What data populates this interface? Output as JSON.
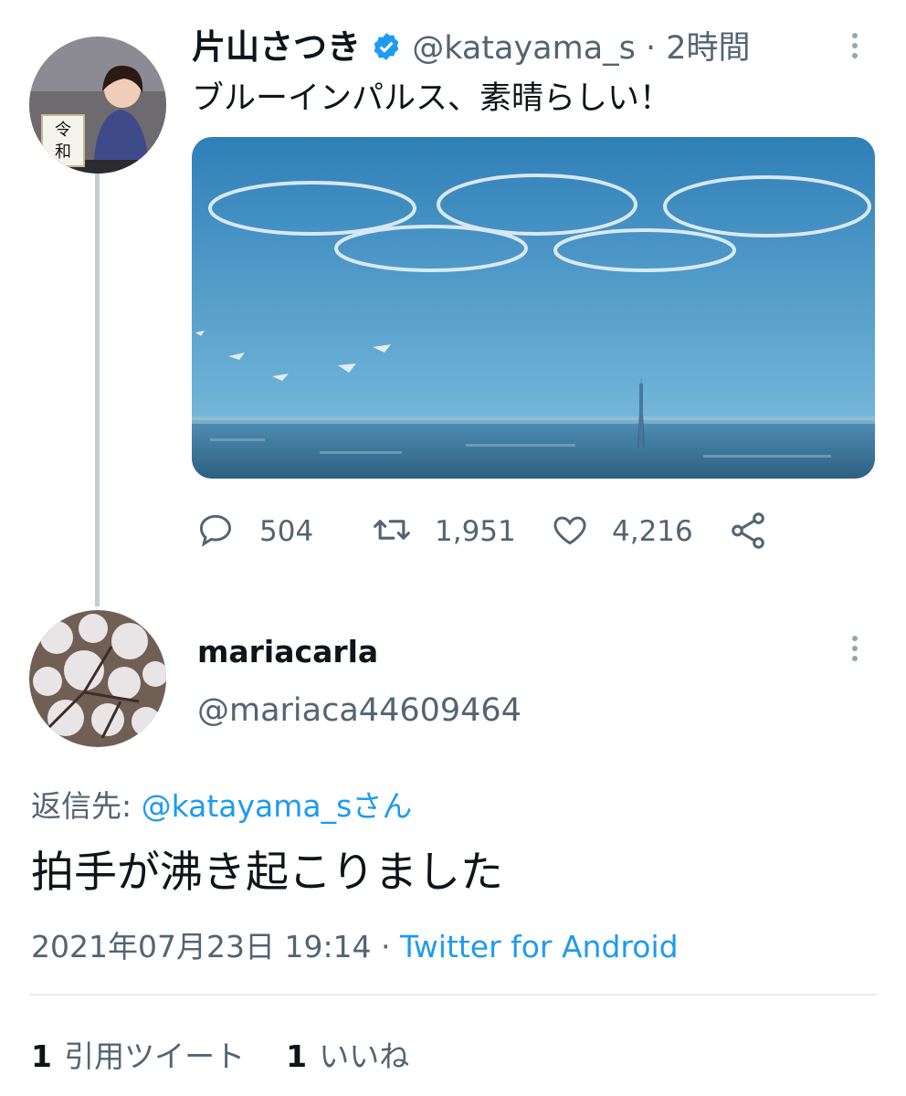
{
  "tweet": {
    "author_name": "片山さつき",
    "handle": "@katayama_s",
    "separator": "·",
    "time_ago": "2時間",
    "text": "ブルーインパルス、素晴らしい！",
    "avatar_label_top": "令",
    "avatar_label_bottom": "和",
    "actions": {
      "reply_count": "504",
      "retweet_count": "1,951",
      "like_count": "4,216"
    }
  },
  "reply": {
    "author_name": "mariacarla",
    "handle": "@mariaca44609464",
    "reply_to_prefix": "返信先: ",
    "reply_to_handle": "@katayama_sさん",
    "text": "拍手が沸き起こりました",
    "timestamp": "2021年07月23日 19:14 · ",
    "client": "Twitter for Android",
    "stats": {
      "quote_count": "1",
      "quote_label": "引用ツイート",
      "like_count": "1",
      "like_label": "いいね"
    }
  },
  "colors": {
    "accent": "#1d9bf0",
    "secondary_text": "#536471",
    "primary_text": "#0f1419",
    "sky": "#3f93c7"
  },
  "icons": [
    "verified-badge-icon",
    "more-icon",
    "reply-icon",
    "retweet-icon",
    "like-icon",
    "share-icon"
  ]
}
